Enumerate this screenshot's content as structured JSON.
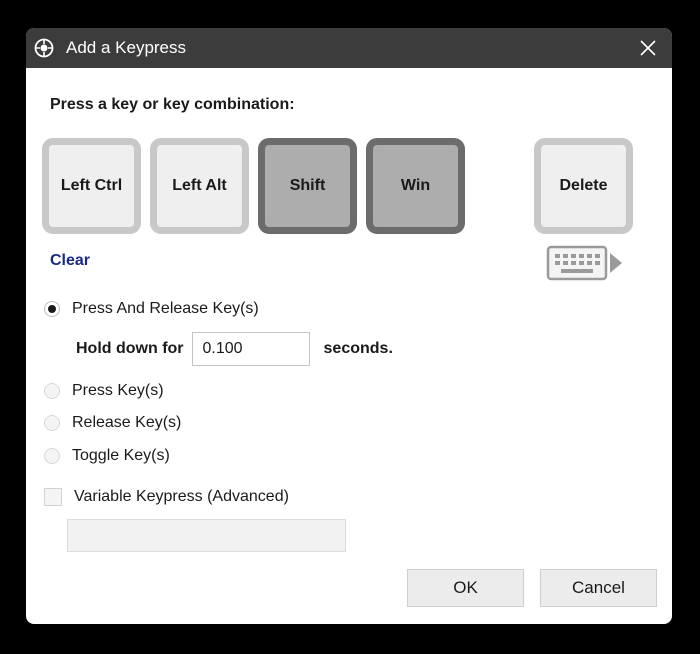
{
  "window": {
    "title": "Add a Keypress",
    "icons": {
      "app": "app-logo-icon",
      "close": "close-icon"
    }
  },
  "prompt": "Press a key or key combination:",
  "keys": [
    {
      "label": "Left Ctrl",
      "active": false
    },
    {
      "label": "Left Alt",
      "active": false
    },
    {
      "label": "Shift",
      "active": true
    },
    {
      "label": "Win",
      "active": true
    },
    {
      "label": "Delete",
      "active": false
    }
  ],
  "clear_label": "Clear",
  "keyboard_icon": "on-screen-keyboard-icon",
  "modes": {
    "selected": "press_and_release",
    "press_and_release": "Press And Release Key(s)",
    "press": "Press Key(s)",
    "release": "Release Key(s)",
    "toggle": "Toggle Key(s)"
  },
  "hold": {
    "prefix": "Hold down for",
    "value": "0.100",
    "suffix": "seconds."
  },
  "variable_keypress": {
    "label": "Variable Keypress (Advanced)",
    "checked": false,
    "value": ""
  },
  "buttons": {
    "ok": "OK",
    "cancel": "Cancel"
  }
}
